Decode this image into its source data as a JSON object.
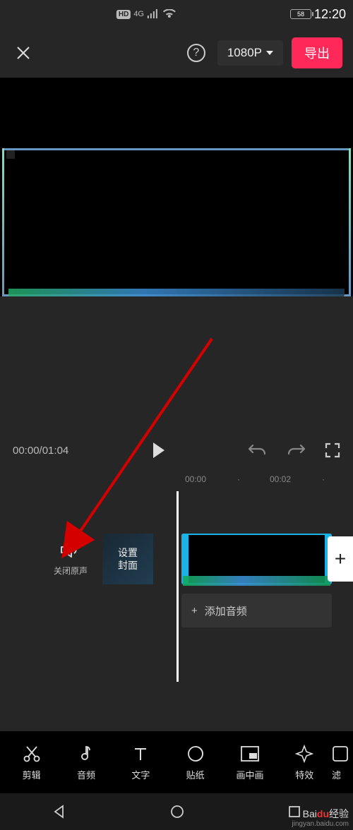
{
  "status": {
    "hd": "HD",
    "network": "4G",
    "battery": "58",
    "time": "12:20"
  },
  "top": {
    "resolution": "1080P",
    "export": "导出"
  },
  "playback": {
    "current": "00:00",
    "total": "01:04",
    "sep": "/"
  },
  "ruler": {
    "t0": "00:00",
    "t1": "00:02"
  },
  "timeline": {
    "mute_label": "关闭原声",
    "cover_label": "设置\n封面",
    "add_audio_plus": "+",
    "add_audio_label": "添加音频",
    "add_clip": "+"
  },
  "tools": [
    {
      "label": "剪辑"
    },
    {
      "label": "音频"
    },
    {
      "label": "文字"
    },
    {
      "label": "贴纸"
    },
    {
      "label": "画中画"
    },
    {
      "label": "特效"
    },
    {
      "label": "滤"
    }
  ],
  "watermark": {
    "brand_prefix": "Bai",
    "brand_mid": "du",
    "brand_suffix": "经验",
    "url": "jingyan.baidu.com"
  }
}
